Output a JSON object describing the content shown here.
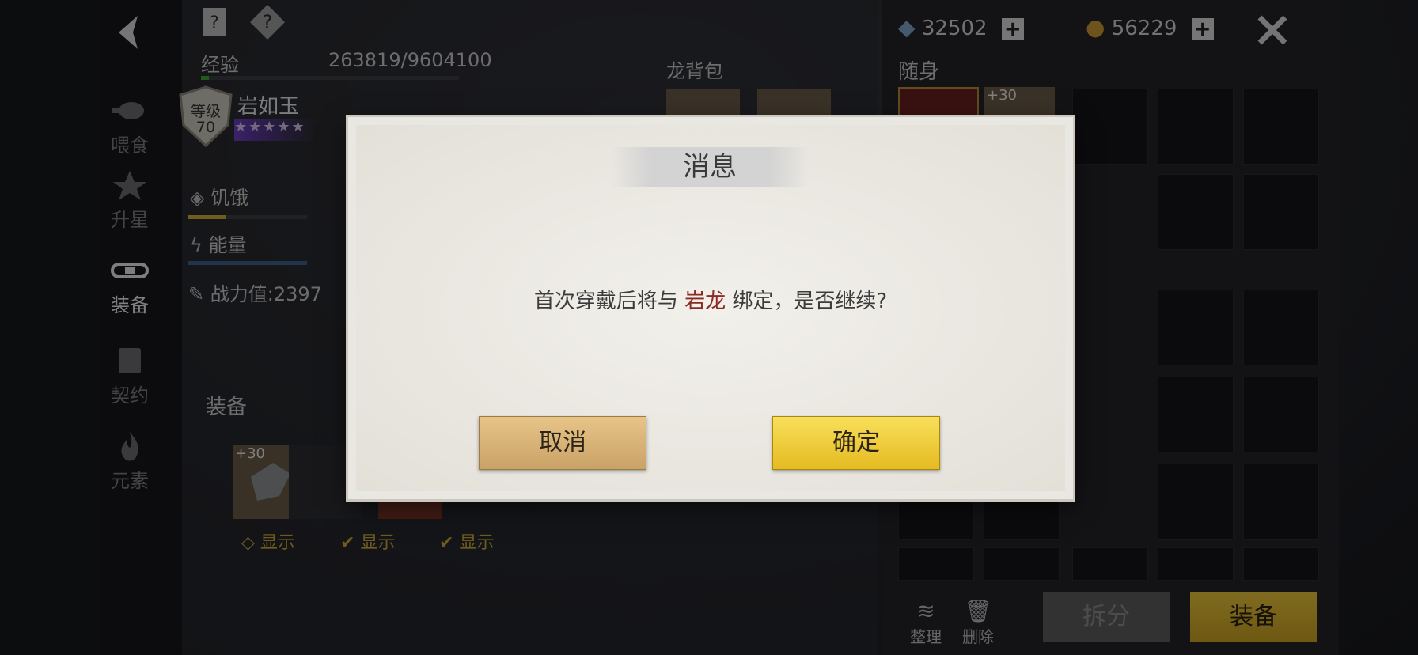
{
  "header": {
    "exp_label": "经验",
    "exp_value": "263819/9604100",
    "bag_label": "龙背包",
    "carry_label": "随身",
    "crystal_count": "32502",
    "coin_count": "56229"
  },
  "nav": {
    "items": [
      {
        "label": "喂食",
        "icon": "meat-icon"
      },
      {
        "label": "升星",
        "icon": "star-icon"
      },
      {
        "label": "装备",
        "icon": "saddle-icon"
      },
      {
        "label": "契约",
        "icon": "scroll-icon"
      },
      {
        "label": "元素",
        "icon": "flame-icon"
      }
    ]
  },
  "dragon": {
    "level_label": "等级",
    "level": "70",
    "name": "岩如玉",
    "stars": 5
  },
  "stats": {
    "hunger_label": "饥饿",
    "energy_label": "能量",
    "power_label": "战力值:2397"
  },
  "equipment": {
    "section_label": "装备",
    "item_bonus": "+30",
    "show_label": "显示"
  },
  "carry": {
    "item_bonus": "+30"
  },
  "dialog": {
    "title": "消息",
    "msg_before": "首次穿戴后将与 ",
    "msg_highlight": "岩龙",
    "msg_after": " 绑定，是否继续?",
    "cancel_label": "取消",
    "confirm_label": "确定"
  },
  "bottom": {
    "sort_label": "整理",
    "delete_label": "删除",
    "split_label": "拆分",
    "equip_label": "装备"
  },
  "colors": {
    "highlight": "#8c2a24",
    "gold": "#e5bb22",
    "accent_purple": "#6c3dbf"
  }
}
